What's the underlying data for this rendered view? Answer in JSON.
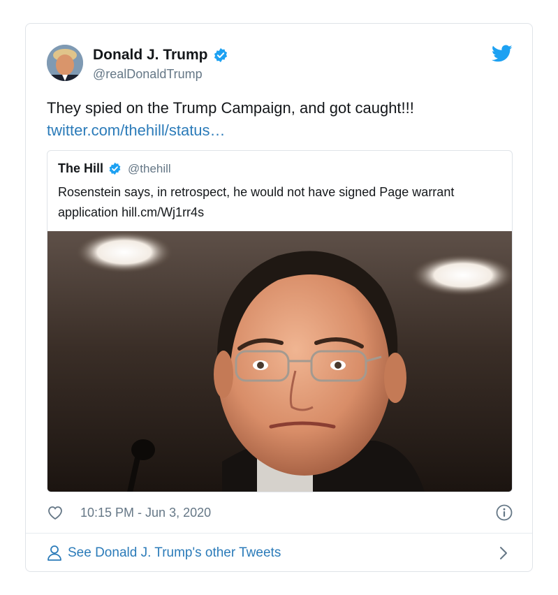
{
  "tweet": {
    "author_name": "Donald J. Trump",
    "author_handle": "@realDonaldTrump",
    "text": "They spied on the Trump Campaign, and got caught!!!",
    "link": "twitter.com/thehill/status…",
    "timestamp": "10:15 PM - Jun 3, 2020",
    "verified": true
  },
  "quoted_tweet": {
    "author_name": "The Hill",
    "author_handle": "@thehill",
    "verified": true,
    "text": "Rosenstein says, in retrospect, he would not have signed Page warrant application hill.cm/Wj1rr4s"
  },
  "footer": {
    "see_more_label": "See Donald J. Trump's other Tweets"
  },
  "icons": {
    "verified": "verified-badge-icon",
    "bird": "twitter-bird-icon",
    "heart": "heart-icon",
    "info": "info-icon",
    "person": "person-icon",
    "chevron": "chevron-right-icon"
  },
  "colors": {
    "brand": "#1da1f2",
    "link": "#2b7bb9",
    "muted": "#657786",
    "text": "#14171a",
    "border": "#dfe3e8"
  }
}
